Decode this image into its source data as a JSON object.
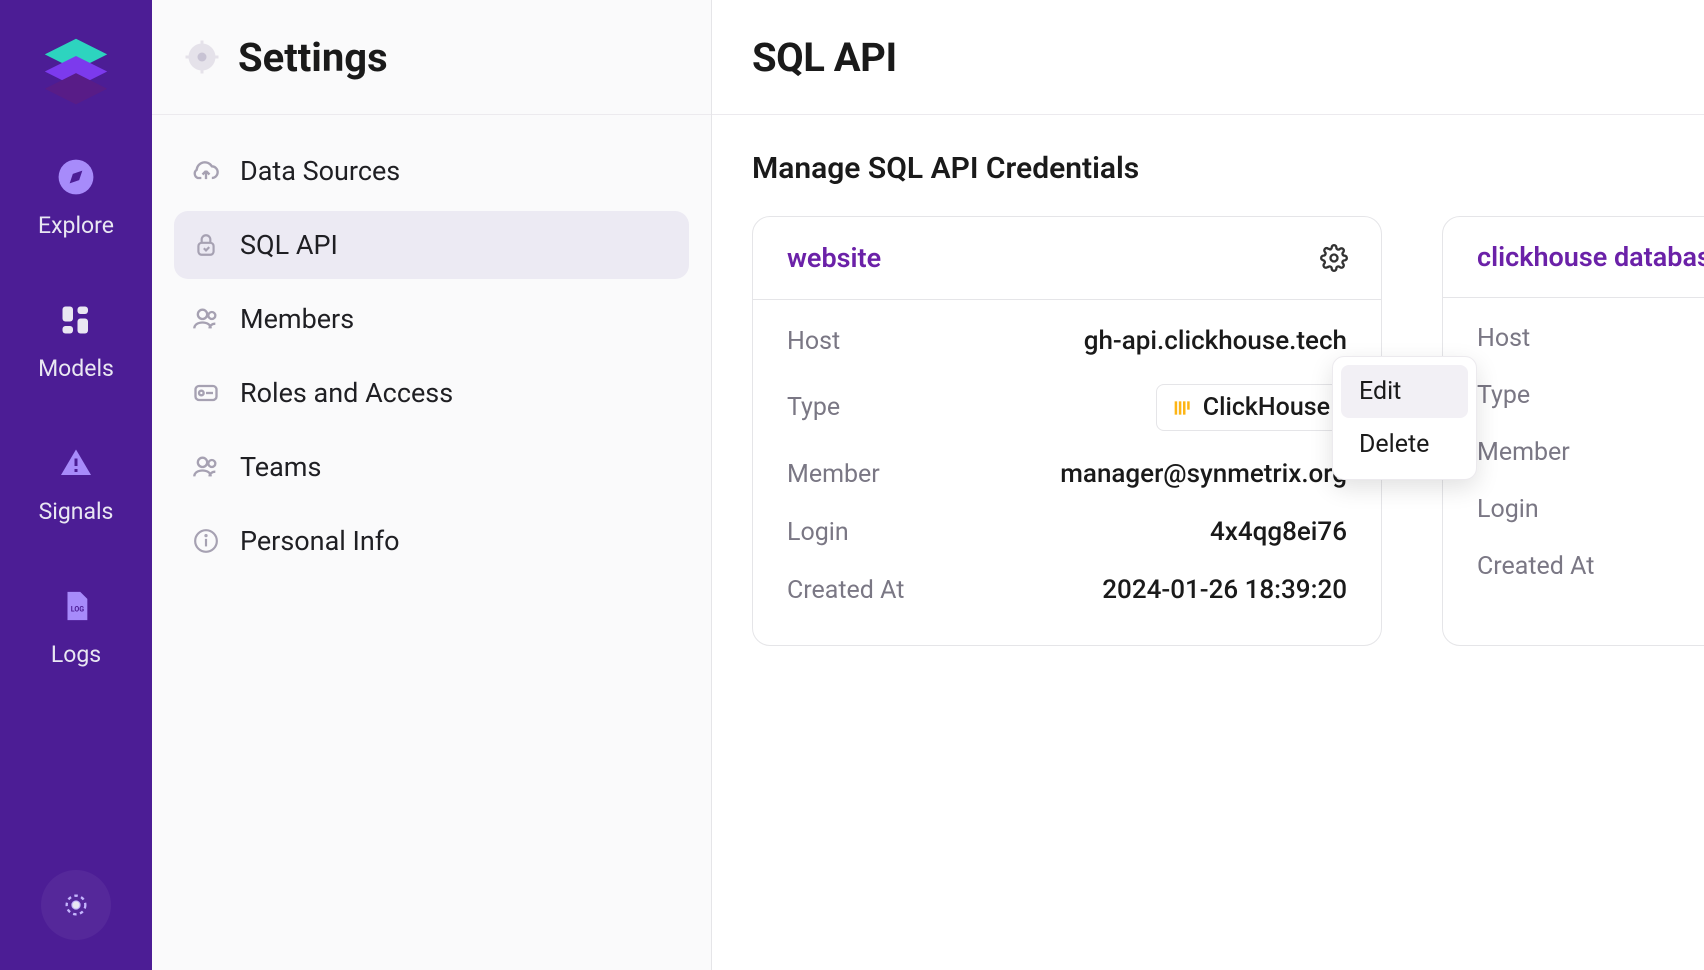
{
  "rail": {
    "items": [
      {
        "id": "explore",
        "label": "Explore"
      },
      {
        "id": "models",
        "label": "Models"
      },
      {
        "id": "signals",
        "label": "Signals"
      },
      {
        "id": "logs",
        "label": "Logs"
      }
    ]
  },
  "settings": {
    "title": "Settings",
    "menu": [
      {
        "id": "data-sources",
        "label": "Data Sources"
      },
      {
        "id": "sql-api",
        "label": "SQL API"
      },
      {
        "id": "members",
        "label": "Members"
      },
      {
        "id": "roles",
        "label": "Roles and Access"
      },
      {
        "id": "teams",
        "label": "Teams"
      },
      {
        "id": "personal",
        "label": "Personal Info"
      }
    ]
  },
  "main": {
    "title": "SQL API",
    "subtitle": "Manage SQL API Credentials",
    "labels": {
      "host": "Host",
      "type": "Type",
      "member": "Member",
      "login": "Login",
      "created_at": "Created At"
    },
    "credentials": [
      {
        "name": "website",
        "host": "gh-api.clickhouse.tech",
        "type": "ClickHouse",
        "member": "manager@synmetrix.org",
        "login": "4x4qg8ei76",
        "created_at": "2024-01-26 18:39:20"
      },
      {
        "name": "clickhouse database",
        "host": "",
        "type": "",
        "member": "",
        "login": "",
        "created_at": ""
      }
    ]
  },
  "dropdown": {
    "edit": "Edit",
    "delete": "Delete"
  }
}
